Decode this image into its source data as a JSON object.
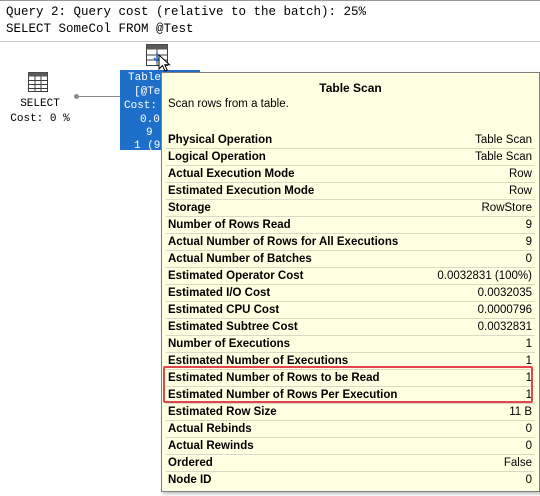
{
  "header": {
    "query_line": "Query 2: Query cost (relative to the batch): 25%",
    "sql_line": "SELECT SomeCol FROM @Test"
  },
  "plan": {
    "select_node": {
      "icon": "select-results-grid-icon",
      "label": "SELECT",
      "cost": "Cost: 0 %"
    },
    "scan_node": {
      "icon": "table-scan-icon",
      "lines": [
        "Table",
        "[@Te",
        "Cost:",
        "0.0",
        "9",
        "1 (9"
      ]
    }
  },
  "tooltip": {
    "title": "Table Scan",
    "description": "Scan rows from a table.",
    "rows": [
      {
        "key": "Physical Operation",
        "value": "Table Scan"
      },
      {
        "key": "Logical Operation",
        "value": "Table Scan"
      },
      {
        "key": "Actual Execution Mode",
        "value": "Row"
      },
      {
        "key": "Estimated Execution Mode",
        "value": "Row"
      },
      {
        "key": "Storage",
        "value": "RowStore"
      },
      {
        "key": "Number of Rows Read",
        "value": "9"
      },
      {
        "key": "Actual Number of Rows for All Executions",
        "value": "9"
      },
      {
        "key": "Actual Number of Batches",
        "value": "0"
      },
      {
        "key": "Estimated Operator Cost",
        "value": "0.0032831 (100%)"
      },
      {
        "key": "Estimated I/O Cost",
        "value": "0.0032035"
      },
      {
        "key": "Estimated CPU Cost",
        "value": "0.0000796"
      },
      {
        "key": "Estimated Subtree Cost",
        "value": "0.0032831"
      },
      {
        "key": "Number of Executions",
        "value": "1"
      },
      {
        "key": "Estimated Number of Executions",
        "value": "1"
      },
      {
        "key": "Estimated Number of Rows to be Read",
        "value": "1"
      },
      {
        "key": "Estimated Number of Rows Per Execution",
        "value": "1"
      },
      {
        "key": "Estimated Row Size",
        "value": "11 B"
      },
      {
        "key": "Actual Rebinds",
        "value": "0"
      },
      {
        "key": "Actual Rewinds",
        "value": "0"
      },
      {
        "key": "Ordered",
        "value": "False"
      },
      {
        "key": "Node ID",
        "value": "0"
      }
    ]
  },
  "colors": {
    "tooltip_bg": "#ffffe1",
    "selected_node": "#1e6fc9",
    "highlight_border": "#e0464c"
  }
}
